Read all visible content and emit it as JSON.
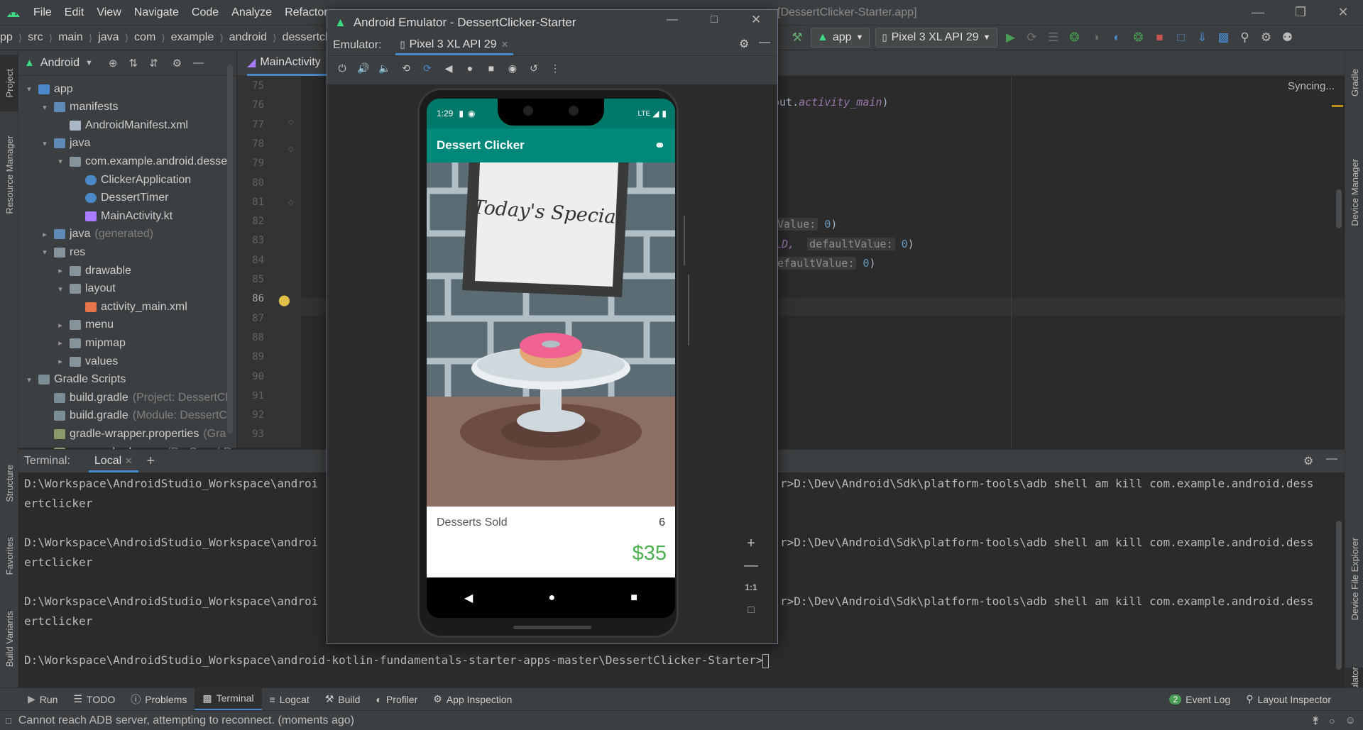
{
  "menubar": {
    "items": [
      "File",
      "Edit",
      "View",
      "Navigate",
      "Code",
      "Analyze",
      "Refactor"
    ],
    "window_title": "[DessertClicker-Starter.app]"
  },
  "navbar": {
    "breadcrumbs": [
      "pp",
      "src",
      "main",
      "java",
      "com",
      "example",
      "android",
      "dessertcl"
    ],
    "run_config": "app",
    "device": "Pixel 3 XL API 29"
  },
  "left_strip": {
    "tabs": [
      "Project",
      "Resource Manager",
      "Structure",
      "Favorites",
      "Build Variants"
    ]
  },
  "right_strip": {
    "tabs": [
      "Gradle",
      "Device Manager",
      "Device File Explorer",
      "Emulator"
    ]
  },
  "project": {
    "view_mode": "Android",
    "tree": [
      {
        "label": "app",
        "hint": "",
        "depth": 0,
        "expanded": true,
        "kind": "module"
      },
      {
        "label": "manifests",
        "hint": "",
        "depth": 1,
        "expanded": true,
        "kind": "folder-blue"
      },
      {
        "label": "AndroidManifest.xml",
        "hint": "",
        "depth": 2,
        "expanded": null,
        "kind": "file"
      },
      {
        "label": "java",
        "hint": "",
        "depth": 1,
        "expanded": true,
        "kind": "folder-blue"
      },
      {
        "label": "com.example.android.desser",
        "hint": "",
        "depth": 2,
        "expanded": true,
        "kind": "folder"
      },
      {
        "label": "ClickerApplication",
        "hint": "",
        "depth": 3,
        "expanded": null,
        "kind": "class"
      },
      {
        "label": "DessertTimer",
        "hint": "",
        "depth": 3,
        "expanded": null,
        "kind": "class"
      },
      {
        "label": "MainActivity.kt",
        "hint": "",
        "depth": 3,
        "expanded": null,
        "kind": "kt"
      },
      {
        "label": "java",
        "hint": "(generated)",
        "depth": 1,
        "expanded": false,
        "kind": "folder-blue"
      },
      {
        "label": "res",
        "hint": "",
        "depth": 1,
        "expanded": true,
        "kind": "folder"
      },
      {
        "label": "drawable",
        "hint": "",
        "depth": 2,
        "expanded": false,
        "kind": "folder"
      },
      {
        "label": "layout",
        "hint": "",
        "depth": 2,
        "expanded": true,
        "kind": "folder"
      },
      {
        "label": "activity_main.xml",
        "hint": "",
        "depth": 3,
        "expanded": null,
        "kind": "xml"
      },
      {
        "label": "menu",
        "hint": "",
        "depth": 2,
        "expanded": false,
        "kind": "folder"
      },
      {
        "label": "mipmap",
        "hint": "",
        "depth": 2,
        "expanded": false,
        "kind": "folder"
      },
      {
        "label": "values",
        "hint": "",
        "depth": 2,
        "expanded": false,
        "kind": "folder"
      },
      {
        "label": "Gradle Scripts",
        "hint": "",
        "depth": 0,
        "expanded": true,
        "kind": "gradle"
      },
      {
        "label": "build.gradle",
        "hint": "(Project: DessertCli",
        "depth": 1,
        "expanded": null,
        "kind": "gradle"
      },
      {
        "label": "build.gradle",
        "hint": "(Module: DessertCl",
        "depth": 1,
        "expanded": null,
        "kind": "gradle"
      },
      {
        "label": "gradle-wrapper.properties",
        "hint": "(Gra",
        "depth": 1,
        "expanded": null,
        "kind": "props"
      },
      {
        "label": "proguard-rules.pro",
        "hint": "(ProGuard R",
        "depth": 1,
        "expanded": null,
        "kind": "props"
      }
    ]
  },
  "editor": {
    "tab": "MainActivity",
    "syncing": "Syncing...",
    "line_numbers": [
      "75",
      "76",
      "77",
      "78",
      "79",
      "80",
      "81",
      "82",
      "83",
      "84",
      "85",
      "86",
      "87",
      "88",
      "89",
      "90",
      "91",
      "92",
      "93"
    ],
    "current_line": "86",
    "code_76_a": "out.",
    "code_76_b": "activity_main",
    "code_76_c": ")",
    "code_84_a": "Value:",
    "code_84_b": "0",
    "code_84_c": ")",
    "code_85_a": "LD,",
    "code_85_b": "defaultValue:",
    "code_85_c": "0",
    "code_85_d": ")",
    "code_87_a": "efaultValue:",
    "code_87_b": "0",
    "code_87_c": ")"
  },
  "terminal": {
    "label": "Terminal:",
    "tab": "Local",
    "lines_left": [
      "D:\\Workspace\\AndroidStudio_Workspace\\androi",
      "ertclicker",
      "",
      "D:\\Workspace\\AndroidStudio_Workspace\\androi",
      "ertclicker",
      "",
      "D:\\Workspace\\AndroidStudio_Workspace\\androi",
      "ertclicker"
    ],
    "lines_right": [
      "r>D:\\Dev\\Android\\Sdk\\platform-tools\\adb shell am kill com.example.android.dess",
      "r>D:\\Dev\\Android\\Sdk\\platform-tools\\adb shell am kill com.example.android.dess",
      "r>D:\\Dev\\Android\\Sdk\\platform-tools\\adb shell am kill com.example.android.dess"
    ],
    "prompt": "D:\\Workspace\\AndroidStudio_Workspace\\android-kotlin-fundamentals-starter-apps-master\\DessertClicker-Starter>"
  },
  "bottom_tabs": {
    "left": [
      "Run",
      "TODO",
      "Problems",
      "Terminal",
      "Logcat",
      "Build",
      "Profiler",
      "App Inspection"
    ],
    "active": "Terminal",
    "event_log": "Event Log",
    "event_count": "2",
    "layout_inspector": "Layout Inspector"
  },
  "status": {
    "message": "Cannot reach ADB server, attempting to reconnect. (moments ago)"
  },
  "emulator": {
    "title": "Android Emulator - DessertClicker-Starter",
    "label": "Emulator:",
    "device_tab": "Pixel 3 XL API 29",
    "zoom_label": "1:1",
    "phone": {
      "time": "1:29",
      "network": "LTE",
      "app_title": "Dessert Clicker",
      "sign": "Today's Special",
      "desserts_sold_label": "Desserts Sold",
      "desserts_sold": "6",
      "revenue": "$35",
      "accent_color": "#00897b",
      "revenue_color": "#4caf50"
    }
  }
}
